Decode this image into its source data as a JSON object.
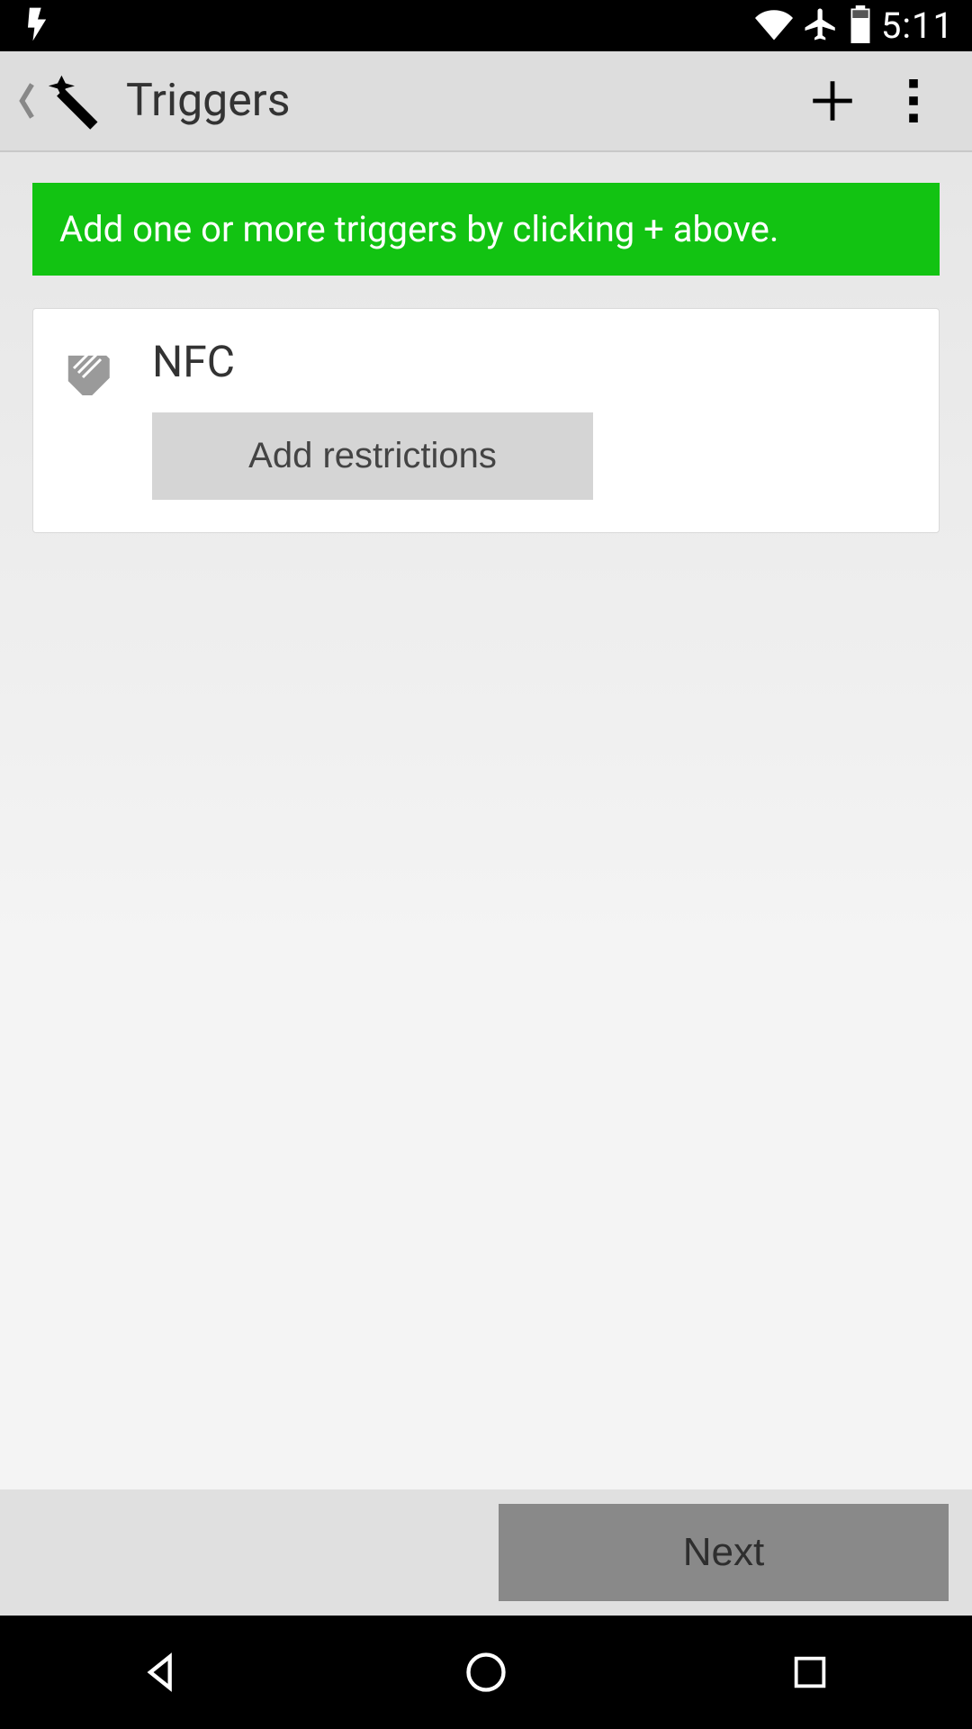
{
  "status": {
    "time": "5:11"
  },
  "appbar": {
    "title": "Triggers"
  },
  "hint": {
    "text": "Add one or more triggers by clicking + above."
  },
  "triggers": [
    {
      "name": "NFC",
      "restrict_label": "Add restrictions"
    }
  ],
  "footer": {
    "next_label": "Next"
  }
}
